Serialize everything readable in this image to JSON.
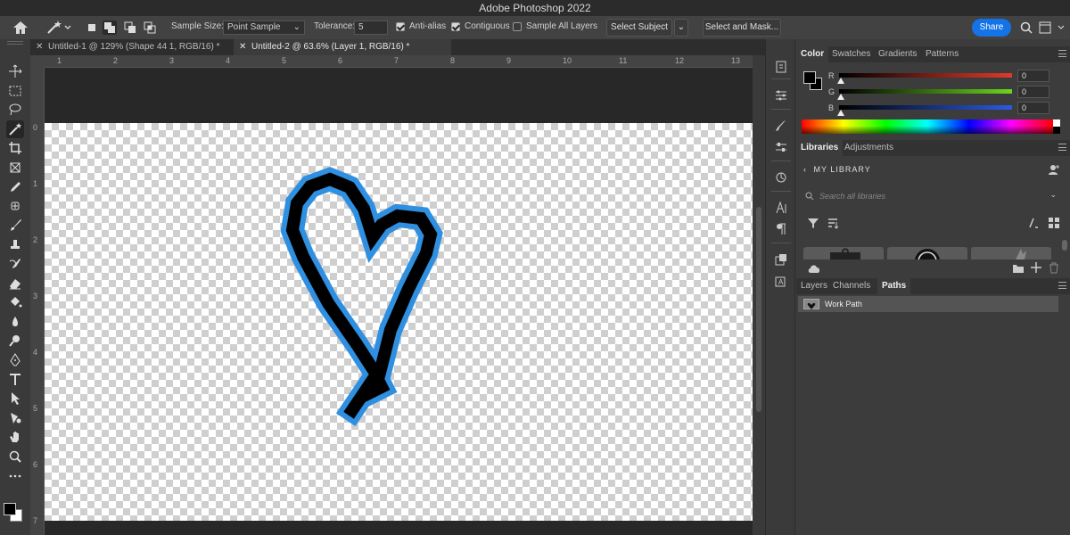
{
  "title_bar": {
    "title": "Adobe Photoshop 2022"
  },
  "options_bar": {
    "sample_size_label": "Sample Size:",
    "sample_size_value": "Point Sample",
    "tolerance_label": "Tolerance:",
    "tolerance_value": "5",
    "anti_alias_label": "Anti-alias",
    "anti_alias_checked": true,
    "contiguous_label": "Contiguous",
    "contiguous_checked": true,
    "sample_all_layers_label": "Sample All Layers",
    "sample_all_layers_checked": false,
    "select_subject_label": "Select Subject",
    "select_mask_label": "Select and Mask...",
    "share_label": "Share",
    "accent_color": "#1473e6"
  },
  "tabs": [
    {
      "label": "Untitled-1 @ 129% (Shape 44 1, RGB/16) *",
      "active": false
    },
    {
      "label": "Untitled-2 @ 63.6% (Layer 1, RGB/16) *",
      "active": true
    }
  ],
  "rulers": {
    "horizontal": [
      "1",
      "2",
      "3",
      "4",
      "5",
      "6",
      "7",
      "8",
      "9",
      "10",
      "11",
      "12",
      "13"
    ],
    "vertical": [
      "0",
      "1",
      "2",
      "3",
      "4",
      "5",
      "6",
      "7"
    ]
  },
  "tools": [
    "move-icon",
    "marquee-icon",
    "lasso-icon",
    "magic-wand-icon",
    "crop-icon",
    "frame-icon",
    "eyedropper-icon",
    "healing-icon",
    "brush-icon",
    "stamp-icon",
    "history-brush-icon",
    "eraser-icon",
    "paint-bucket-icon",
    "blur-icon",
    "dodge-icon",
    "pen-icon",
    "type-icon",
    "path-select-icon",
    "shape-icon",
    "hand-icon",
    "zoom-icon",
    "more-tools-icon"
  ],
  "color_panel": {
    "tabs": [
      "Color",
      "Swatches",
      "Gradients",
      "Patterns"
    ],
    "active_tab": "Color",
    "sliders": [
      {
        "label": "R",
        "value": "0",
        "color": "#e03a2a"
      },
      {
        "label": "G",
        "value": "0",
        "color": "#6ad41f"
      },
      {
        "label": "B",
        "value": "0",
        "color": "#2a5ae0"
      }
    ]
  },
  "libraries_panel": {
    "tabs": [
      "Libraries",
      "Adjustments"
    ],
    "active_tab": "Libraries",
    "library_name": "MY LIBRARY",
    "search_placeholder": "Search all libraries"
  },
  "paths_panel": {
    "tabs": [
      "Layers",
      "Channels",
      "Paths"
    ],
    "active_tab": "Paths",
    "items": [
      {
        "label": "Work Path"
      }
    ]
  },
  "canvas": {
    "heart_outline_color": "#2f8fe0",
    "heart_stroke_color": "#000000"
  }
}
